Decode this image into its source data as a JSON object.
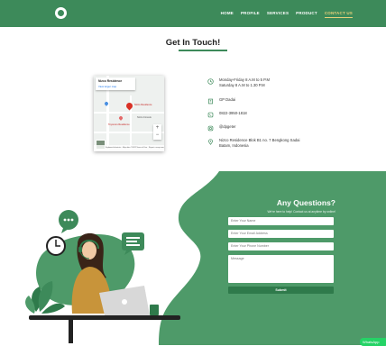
{
  "navbar": {
    "links": [
      {
        "label": "HOME"
      },
      {
        "label": "PROFILE"
      },
      {
        "label": "SERVICES"
      },
      {
        "label": "PRODUCT"
      },
      {
        "label": "CONTACT US"
      }
    ],
    "active_index": 4
  },
  "contact": {
    "heading": "Get In Touch!",
    "map": {
      "place_name": "Nizco Residence",
      "link": "View larger map",
      "labels": [
        "Nizco Residence",
        "Toyonuru Residence",
        "Nizco Forests"
      ],
      "footer": "Keyboard shortcuts · Map data ©2022 Terms of Use · Report a map error"
    },
    "info": [
      {
        "icon": "clock-icon",
        "lines": [
          "Monday-Friday 8 A.M to 5 P.M",
          "Saturday 8 A.M to 1.30 P.M"
        ]
      },
      {
        "icon": "building-icon",
        "lines": [
          "GP Dadai"
        ]
      },
      {
        "icon": "phone-icon",
        "lines": [
          "0822-3950-1818"
        ]
      },
      {
        "icon": "instagram-icon",
        "lines": [
          "@dpgeter"
        ]
      },
      {
        "icon": "location-pin-icon",
        "lines": [
          "Nizco Residence Blok B1 no. 7 Bengkong Sadai",
          "Batam, Indonesia"
        ]
      }
    ]
  },
  "form": {
    "title": "Any Questions?",
    "subtitle": "We're here to help! Contact us at anytime by online!",
    "name_placeholder": "Enter Your Name",
    "email_placeholder": "Enter Your Email Address",
    "phone_placeholder": "Enter Your Phone Number",
    "message_placeholder": "Message",
    "submit_label": "Submit"
  },
  "whatsapp": {
    "label": "WhatsApp"
  },
  "colors": {
    "primary": "#3d8a5a",
    "accent": "#e8d17a",
    "dark_green": "#2f7a4b"
  }
}
